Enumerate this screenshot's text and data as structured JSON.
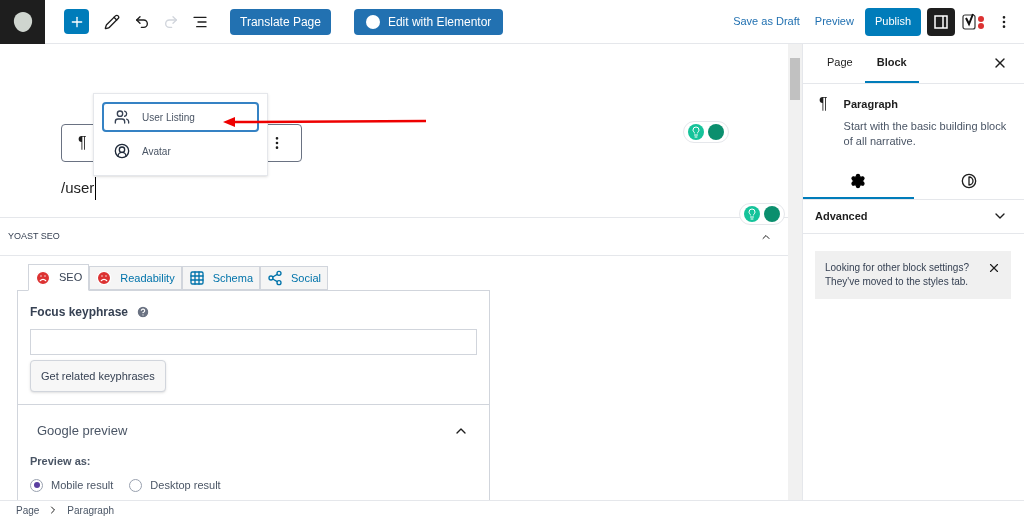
{
  "toolbar": {
    "buttons": [
      "Translate Page",
      "Edit with Elementor"
    ],
    "save_draft": "Save as Draft",
    "preview": "Preview",
    "publish": "Publish",
    "settings_on": true
  },
  "editor": {
    "typed_text": "/user",
    "block_toolbar": {
      "paragraph_symbol": "¶"
    },
    "suggestions": [
      {
        "label": "User Listing",
        "selected": true,
        "kind": "users"
      },
      {
        "label": "Avatar",
        "selected": false,
        "kind": "avatar"
      }
    ]
  },
  "yoast": {
    "title": "YOAST SEO",
    "tabs": [
      {
        "label": "SEO",
        "selected": true,
        "kind": "face"
      },
      {
        "label": "Readability",
        "selected": false,
        "kind": "face"
      },
      {
        "label": "Schema",
        "selected": false,
        "kind": "grid"
      },
      {
        "label": "Social",
        "selected": false,
        "kind": "share"
      }
    ],
    "focus_label": "Focus keyphrase",
    "related_button": "Get related keyphrases",
    "google_preview": "Google preview",
    "preview_as": "Preview as:",
    "preview_options": [
      {
        "label": "Mobile result",
        "selected": true
      },
      {
        "label": "Desktop result",
        "selected": false
      }
    ]
  },
  "breadcrumbs": [
    "Page",
    "Paragraph"
  ],
  "sidebar": {
    "tabs": [
      {
        "label": "Page",
        "selected": false
      },
      {
        "label": "Block",
        "selected": true
      }
    ],
    "block_title": "Paragraph",
    "block_symbol": "¶",
    "block_description": "Start with the basic building block of all narrative.",
    "setting_tabs": [
      {
        "kind": "gear",
        "selected": true
      },
      {
        "kind": "contrast",
        "selected": false
      }
    ],
    "advanced": "Advanced",
    "notice": "Looking for other block settings? They've moved to the styles tab."
  }
}
